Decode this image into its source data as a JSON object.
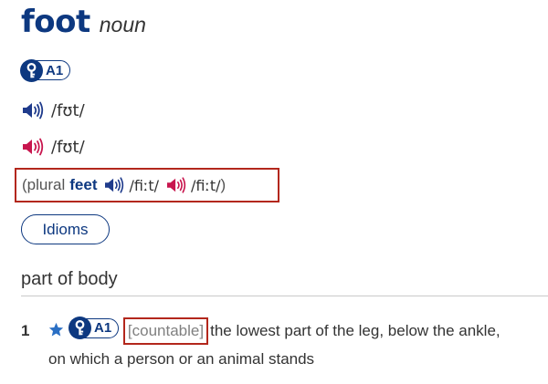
{
  "entry": {
    "headword": "foot",
    "part_of_speech": "noun",
    "level": "A1",
    "pron_uk": "/fʊt/",
    "pron_us": "/fʊt/",
    "plural": {
      "open": "(plural",
      "form": "feet",
      "pron_uk": "/fiːt/",
      "pron_us": "/fiːt/",
      "close": ")"
    },
    "idioms_label": "Idioms",
    "section": "part of body",
    "sense": {
      "number": "1",
      "level": "A1",
      "grammar": "[countable]",
      "definition_line1": "the lowest part of the leg, below the ankle,",
      "definition_line2": "on which a person or an animal stands"
    }
  },
  "icons": {
    "key": "key-icon",
    "speaker_uk": "speaker-uk-icon",
    "speaker_us": "speaker-us-icon",
    "star": "star-icon"
  },
  "colors": {
    "brand": "#0d3880",
    "uk_speaker": "#1f3b8c",
    "us_speaker": "#c8164e",
    "highlight_box": "#b3271c",
    "star": "#2a6fc4"
  }
}
